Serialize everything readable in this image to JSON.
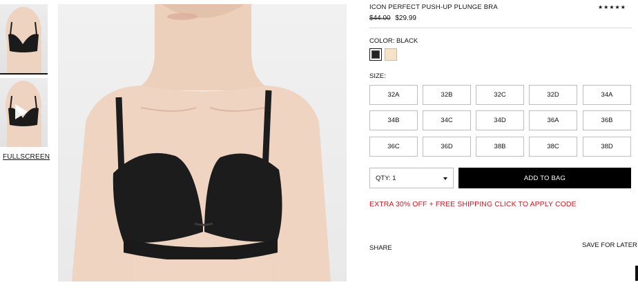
{
  "product": {
    "title": "ICON PERFECT PUSH-UP PLUNGE BRA",
    "rating_stars": "★★★★★",
    "price_original": "$44.00",
    "price_sale": "$29.99"
  },
  "color": {
    "label": "COLOR: BLACK",
    "swatches": [
      {
        "name": "black",
        "hex": "#222222",
        "selected": true
      },
      {
        "name": "nude",
        "hex": "#f6e2c6",
        "selected": false
      }
    ]
  },
  "size": {
    "label": "SIZE:",
    "options": [
      "32A",
      "32B",
      "32C",
      "32D",
      "34A",
      "34B",
      "34C",
      "34D",
      "36A",
      "36B",
      "36C",
      "36D",
      "38B",
      "38C",
      "38D"
    ]
  },
  "qty": {
    "label": "QTY: 1"
  },
  "actions": {
    "add_to_bag": "ADD TO BAG",
    "promo": "EXTRA 30% OFF + FREE SHIPPING  CLICK TO APPLY CODE",
    "share": "SHARE",
    "save_later": "SAVE FOR LATER"
  },
  "gallery": {
    "fullscreen": "FULLSCREEN"
  },
  "colors": {
    "accent": "#e0141e",
    "button": "#000000"
  }
}
